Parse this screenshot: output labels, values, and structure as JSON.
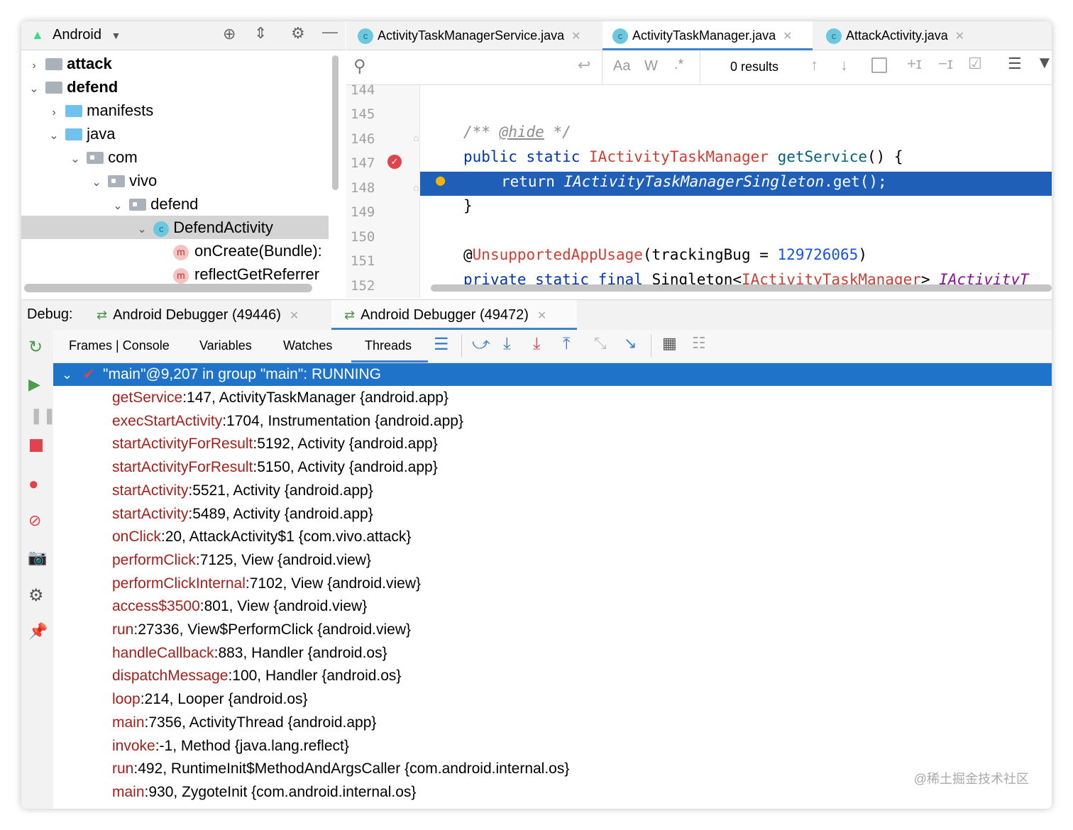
{
  "project_panel": {
    "view_label": "Android",
    "tree": [
      {
        "label": "attack",
        "bold": true
      },
      {
        "label": "defend",
        "bold": true
      },
      {
        "label": "manifests"
      },
      {
        "label": "java"
      },
      {
        "label": "com"
      },
      {
        "label": "vivo"
      },
      {
        "label": "defend"
      },
      {
        "label": "DefendActivity"
      },
      {
        "label": "onCreate(Bundle):"
      },
      {
        "label": "reflectGetReferrer"
      }
    ]
  },
  "editor": {
    "tabs": [
      {
        "label": "ActivityTaskManagerService.java"
      },
      {
        "label": "ActivityTaskManager.java"
      },
      {
        "label": "AttackActivity.java"
      }
    ],
    "search": {
      "results": "0 results",
      "case_label": "Aa",
      "word_label": "W",
      "regex_label": ".*"
    },
    "line_numbers": [
      "144",
      "145",
      "146",
      "147",
      "148",
      "149",
      "150",
      "151",
      "152"
    ],
    "code": {
      "l145_comment_a": "/** ",
      "l145_hide": "@hide",
      "l145_comment_b": " */",
      "l146_public": "public",
      "l146_static": "static",
      "l146_type": "IActivityTaskManager",
      "l146_fn": "getService",
      "l146_rest": "() {",
      "l147_return": "return ",
      "l147_call": "IActivityTaskManagerSingleton",
      "l147_rest": ".get();",
      "l148": "}",
      "l150_at": "@",
      "l150_ann": "UnsupportedAppUsage",
      "l150_mid": "(trackingBug = ",
      "l150_num": "129726065",
      "l150_end": ")",
      "l151_private": "private",
      "l151_static": "static",
      "l151_final": "final",
      "l151_singleton": "Singleton<",
      "l151_type": "IActivityTaskManager",
      "l151_gt": "> ",
      "l151_field": "IActivityT"
    }
  },
  "debug": {
    "label": "Debug:",
    "sessions": [
      {
        "label": "Android Debugger (49446)"
      },
      {
        "label": "Android Debugger (49472)"
      }
    ],
    "tabs": [
      "Frames | Console",
      "Variables",
      "Watches",
      "Threads"
    ],
    "thread": "\"main\"@9,207 in group \"main\": RUNNING",
    "frames": [
      {
        "method": "getService",
        "rest": ":147, ActivityTaskManager {android.app}"
      },
      {
        "method": "execStartActivity",
        "rest": ":1704, Instrumentation {android.app}"
      },
      {
        "method": "startActivityForResult",
        "rest": ":5192, Activity {android.app}"
      },
      {
        "method": "startActivityForResult",
        "rest": ":5150, Activity {android.app}"
      },
      {
        "method": "startActivity",
        "rest": ":5521, Activity {android.app}"
      },
      {
        "method": "startActivity",
        "rest": ":5489, Activity {android.app}"
      },
      {
        "method": "onClick",
        "rest": ":20, AttackActivity$1 {com.vivo.attack}"
      },
      {
        "method": "performClick",
        "rest": ":7125, View {android.view}"
      },
      {
        "method": "performClickInternal",
        "rest": ":7102, View {android.view}"
      },
      {
        "method": "access$3500",
        "rest": ":801, View {android.view}"
      },
      {
        "method": "run",
        "rest": ":27336, View$PerformClick {android.view}"
      },
      {
        "method": "handleCallback",
        "rest": ":883, Handler {android.os}"
      },
      {
        "method": "dispatchMessage",
        "rest": ":100, Handler {android.os}"
      },
      {
        "method": "loop",
        "rest": ":214, Looper {android.os}"
      },
      {
        "method": "main",
        "rest": ":7356, ActivityThread {android.app}"
      },
      {
        "method": "invoke",
        "rest": ":-1, Method {java.lang.reflect}"
      },
      {
        "method": "run",
        "rest": ":492, RuntimeInit$MethodAndArgsCaller {com.android.internal.os}"
      },
      {
        "method": "main",
        "rest": ":930, ZygoteInit {com.android.internal.os}"
      }
    ]
  },
  "watermark": "@稀土掘金技术社区",
  "colors": {
    "accent": "#1f5fb7",
    "selection": "#1f73c9",
    "method": "#a3201b"
  }
}
